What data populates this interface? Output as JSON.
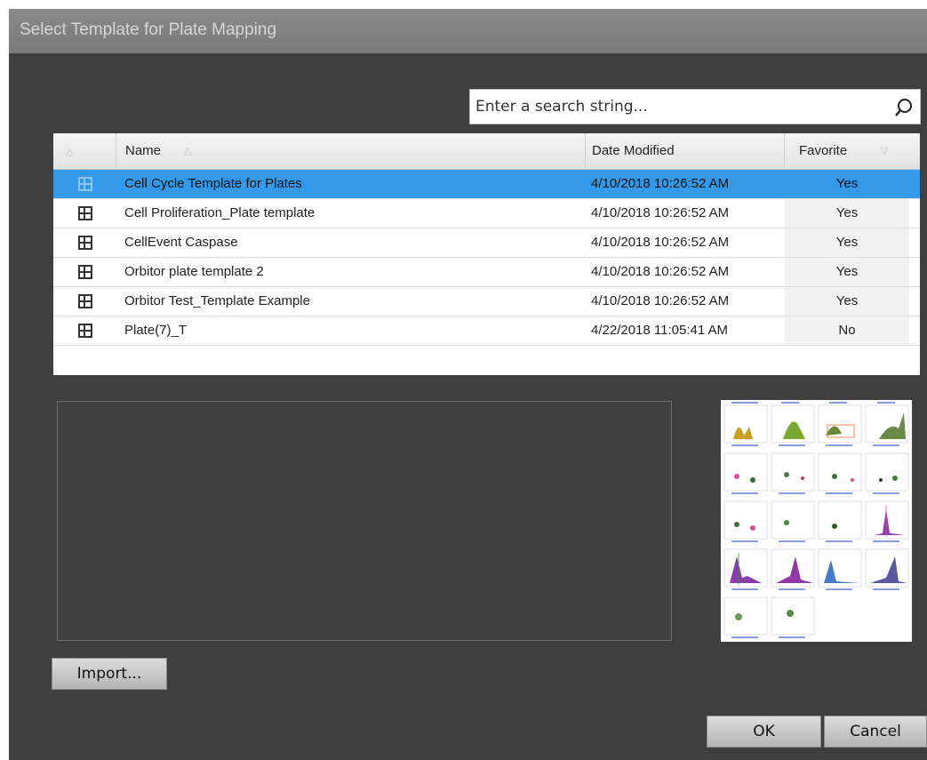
{
  "dialog": {
    "title": "Select Template for Plate Mapping"
  },
  "search": {
    "placeholder": "Enter a search string...",
    "icon": "search-icon"
  },
  "table": {
    "columns": {
      "name": "Name",
      "date_modified": "Date Modified",
      "favorite": "Favorite"
    },
    "rows": [
      {
        "name": "Cell Cycle Template for Plates",
        "date_modified": "4/10/2018 10:26:52 AM",
        "favorite": "Yes",
        "selected": true
      },
      {
        "name": "Cell Proliferation_Plate template",
        "date_modified": "4/10/2018 10:26:52 AM",
        "favorite": "Yes"
      },
      {
        "name": "CellEvent Caspase",
        "date_modified": "4/10/2018 10:26:52 AM",
        "favorite": "Yes"
      },
      {
        "name": "Orbitor plate template 2",
        "date_modified": "4/10/2018 10:26:52 AM",
        "favorite": "Yes"
      },
      {
        "name": "Orbitor Test_Template Example",
        "date_modified": "4/10/2018 10:26:52 AM",
        "favorite": "Yes"
      },
      {
        "name": "Plate(7)_T",
        "date_modified": "4/22/2018 11:05:41 AM",
        "favorite": "No"
      }
    ]
  },
  "buttons": {
    "import": "Import...",
    "ok": "OK",
    "cancel": "Cancel"
  },
  "colors": {
    "dialog_bg": "#3f3f3f",
    "selection": "#3399e8",
    "title_bar": "#808080"
  }
}
